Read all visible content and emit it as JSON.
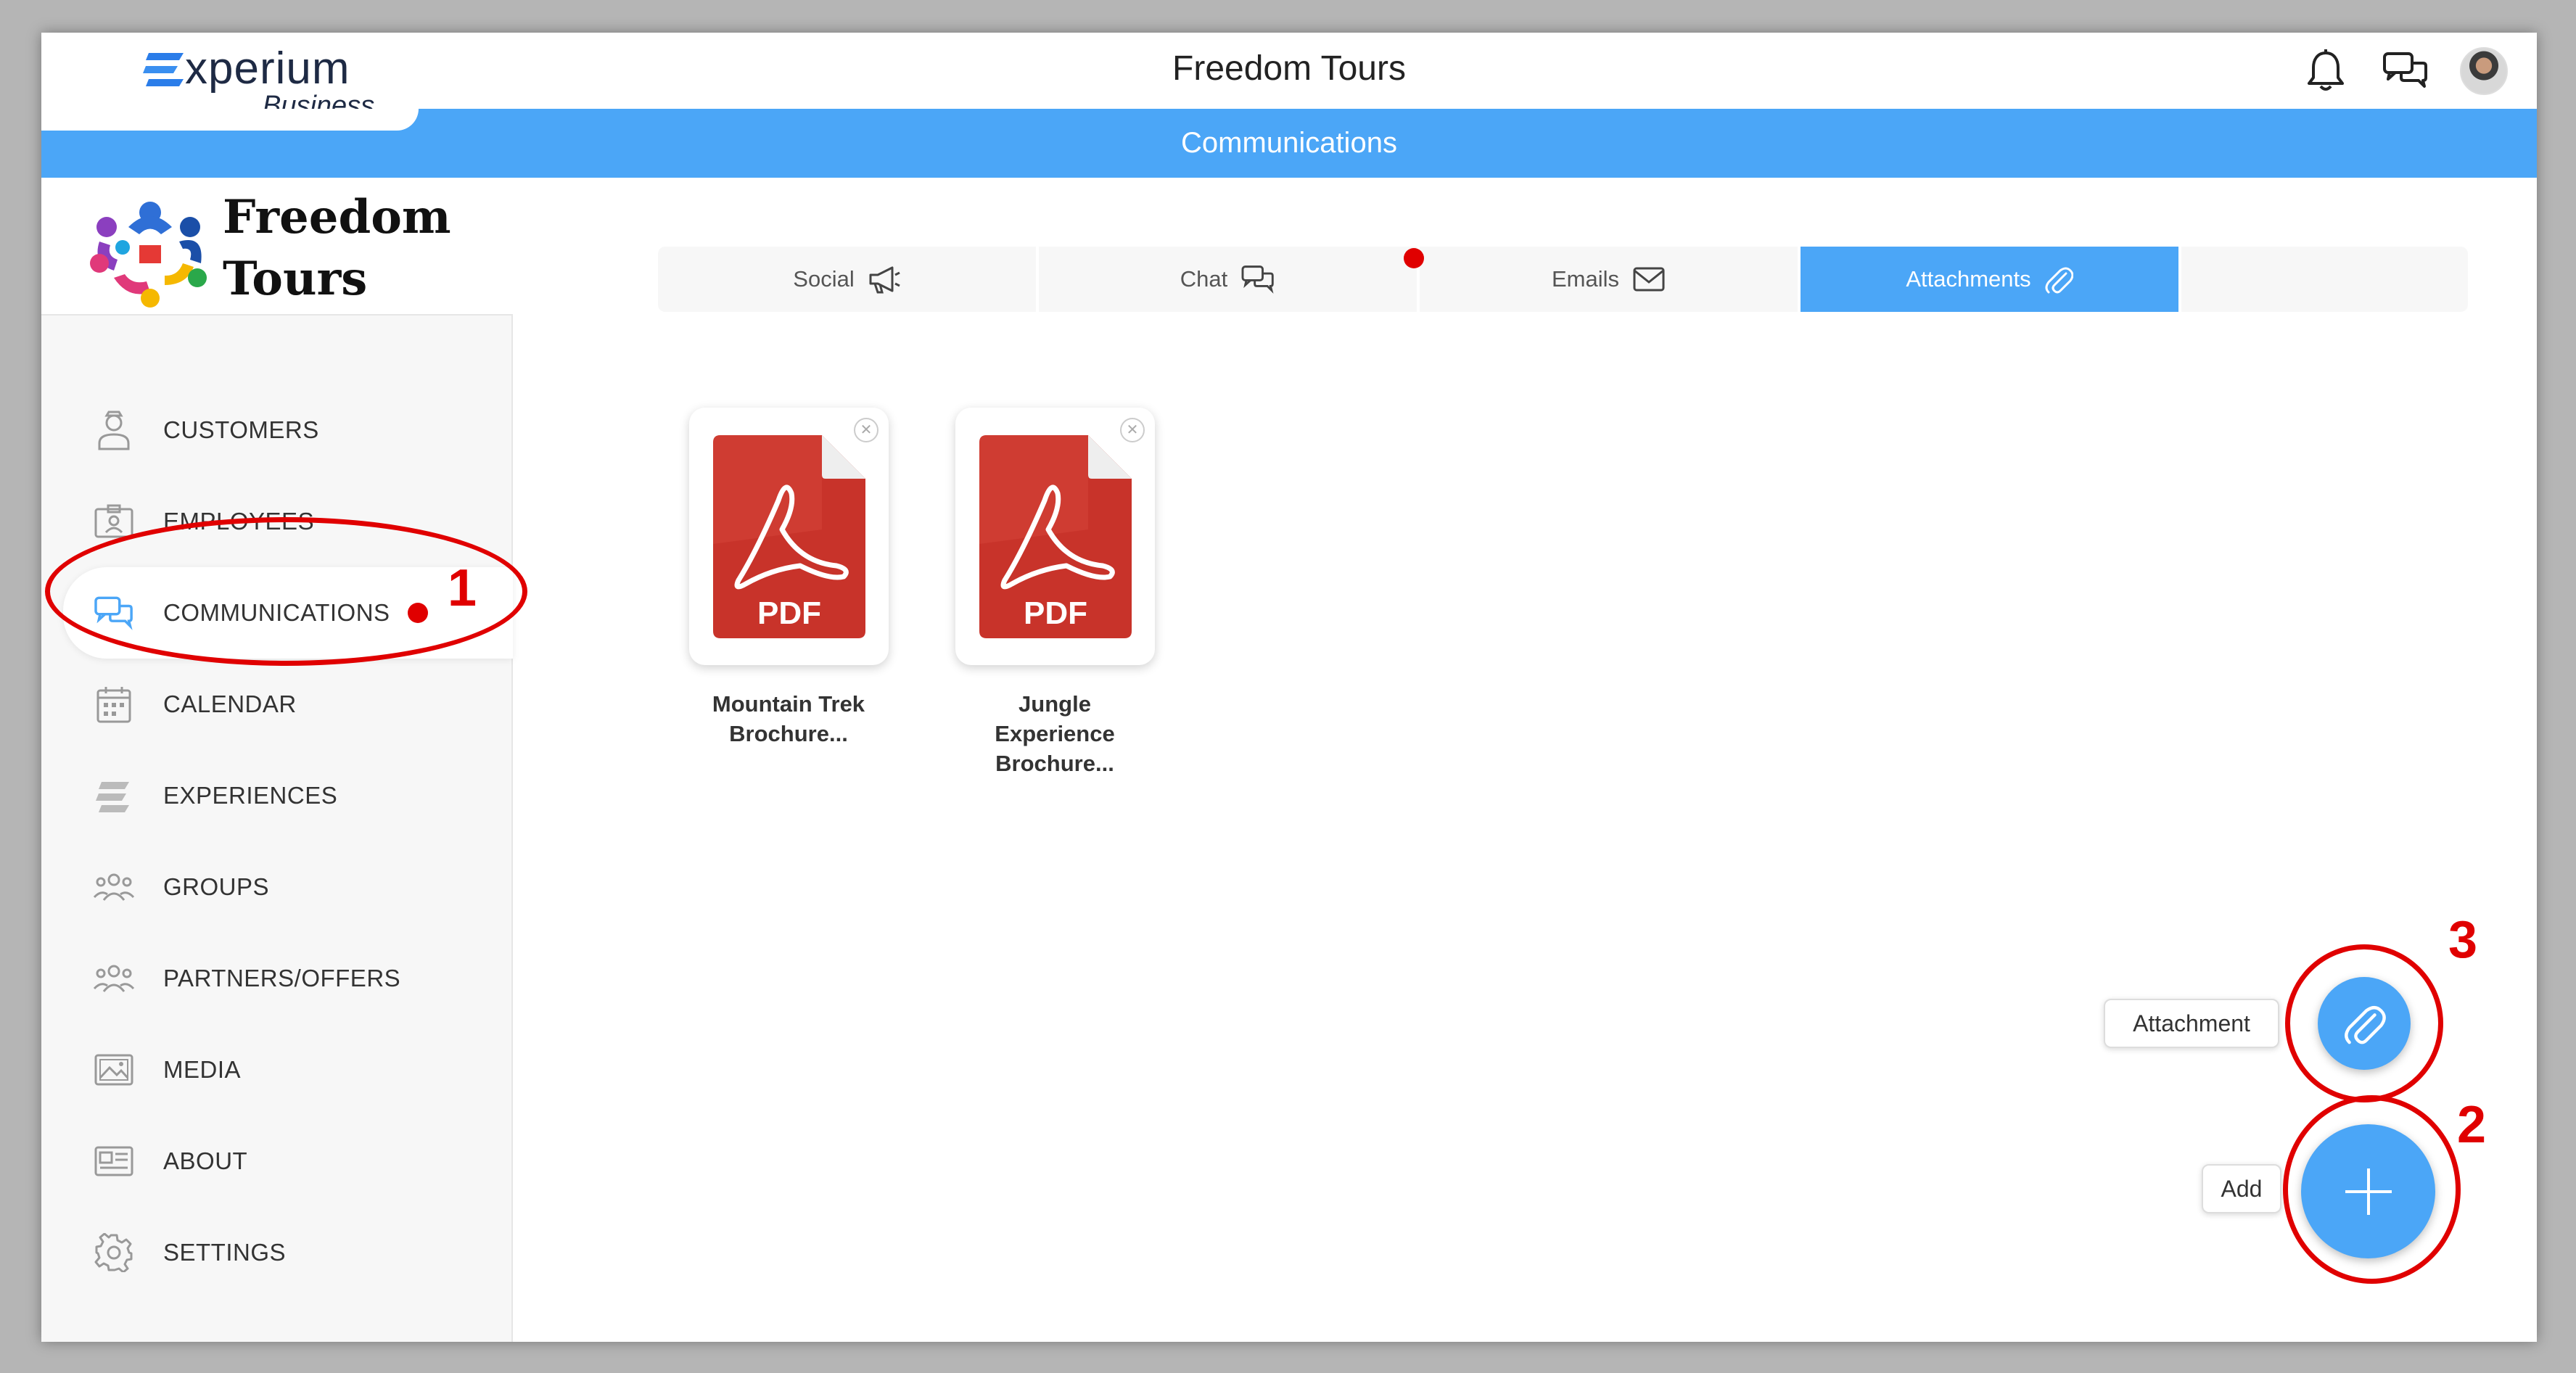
{
  "header": {
    "logo_word": "xperium",
    "logo_sub": "Business",
    "app_title": "Freedom Tours",
    "section_title": "Communications"
  },
  "sidebar": {
    "brand_line1": "Freedom",
    "brand_line2": "Tours",
    "items": [
      {
        "label": "CUSTOMERS",
        "icon": "customer-icon"
      },
      {
        "label": "EMPLOYEES",
        "icon": "id-badge-icon"
      },
      {
        "label": "COMMUNICATIONS",
        "icon": "chat-bubbles-icon",
        "active": true
      },
      {
        "label": "CALENDAR",
        "icon": "calendar-icon"
      },
      {
        "label": "EXPERIENCES",
        "icon": "experiences-icon"
      },
      {
        "label": "GROUPS",
        "icon": "group-icon"
      },
      {
        "label": "PARTNERS/OFFERS",
        "icon": "partners-icon"
      },
      {
        "label": "MEDIA",
        "icon": "image-icon"
      },
      {
        "label": "ABOUT",
        "icon": "newspaper-icon"
      },
      {
        "label": "SETTINGS",
        "icon": "gear-icon"
      }
    ]
  },
  "tabs": [
    {
      "label": "Social",
      "icon": "megaphone-icon"
    },
    {
      "label": "Chat",
      "icon": "chat-bubbles-icon"
    },
    {
      "label": "Emails",
      "icon": "envelope-icon"
    },
    {
      "label": "Attachments",
      "icon": "paperclip-icon",
      "active": true
    }
  ],
  "files": [
    {
      "name_line1": "Mountain Trek",
      "name_line2": "Brochure...",
      "name_line3": "",
      "type": "PDF"
    },
    {
      "name_line1": "Jungle",
      "name_line2": "Experience",
      "name_line3": "Brochure...",
      "type": "PDF"
    }
  ],
  "fab": {
    "attachment_label": "Attachment",
    "add_label": "Add"
  },
  "annotations": {
    "one": "1",
    "two": "2",
    "three": "3"
  },
  "colors": {
    "accent": "#4ba6f7",
    "annotation": "#e00000",
    "pdf_red": "#c8332a"
  }
}
